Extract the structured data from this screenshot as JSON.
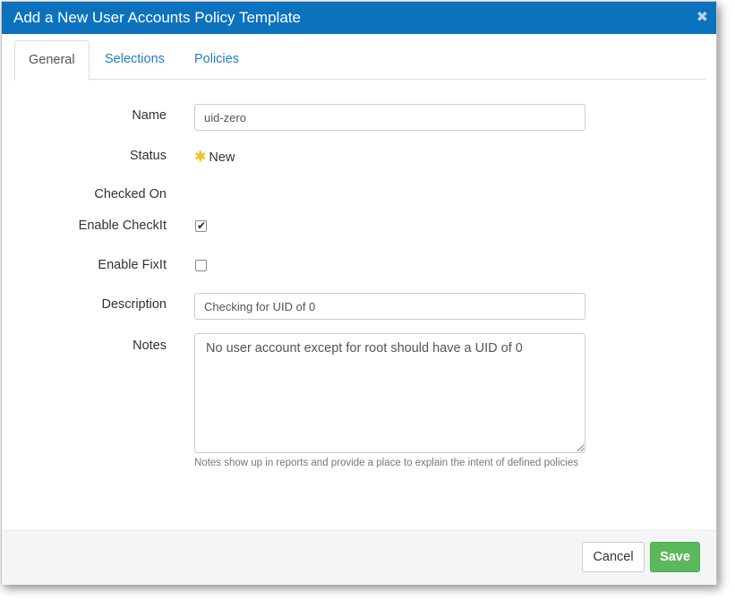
{
  "dialog": {
    "title": "Add a New User Accounts Policy Template",
    "close_glyph": "✖"
  },
  "tabs": [
    {
      "label": "General",
      "active": true
    },
    {
      "label": "Selections",
      "active": false
    },
    {
      "label": "Policies",
      "active": false
    }
  ],
  "form": {
    "name_label": "Name",
    "name_value": "uid-zero",
    "status_label": "Status",
    "status_icon": "asterisk-icon",
    "status_value": "New",
    "checked_on_label": "Checked On",
    "enable_checkit_label": "Enable CheckIt",
    "enable_checkit_checked": true,
    "enable_fixit_label": "Enable FixIt",
    "enable_fixit_checked": false,
    "description_label": "Description",
    "description_value": "Checking for UID of 0",
    "notes_label": "Notes",
    "notes_value": "No user account except for root should have a UID of 0",
    "notes_help": "Notes show up in reports and provide a place to explain the intent of defined policies"
  },
  "footer": {
    "cancel_label": "Cancel",
    "save_label": "Save"
  },
  "colors": {
    "titlebar": "#0d72be",
    "tab_link": "#2a7bbf",
    "save": "#5cb85c",
    "status_star": "#f0c419"
  }
}
